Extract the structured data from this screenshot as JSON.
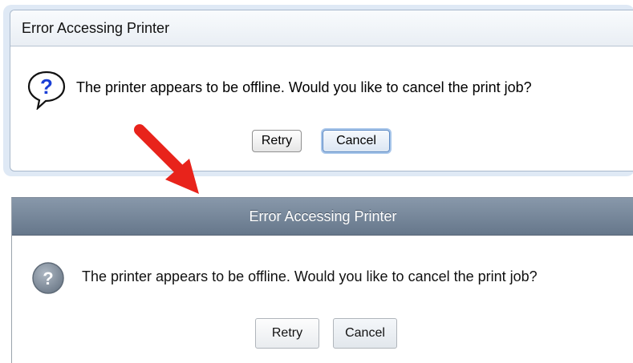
{
  "dialog_old": {
    "title": "Error Accessing Printer",
    "message": "The printer appears to be offline. Would you like to cancel the print job?",
    "icon": "question-bubble-icon",
    "buttons": {
      "retry": "Retry",
      "cancel": "Cancel"
    }
  },
  "dialog_new": {
    "title": "Error Accessing Printer",
    "message": "The printer appears to be offline. Would you like to cancel the print job?",
    "icon": "question-circle-icon",
    "buttons": {
      "retry": "Retry",
      "cancel": "Cancel"
    }
  },
  "annotation": {
    "icon": "red-arrow-icon",
    "color": "#e8231b"
  },
  "colors": {
    "old_focus_ring": "#a8c6ea",
    "new_titlebar": "#718297",
    "question_blue": "#1a3fd6"
  }
}
